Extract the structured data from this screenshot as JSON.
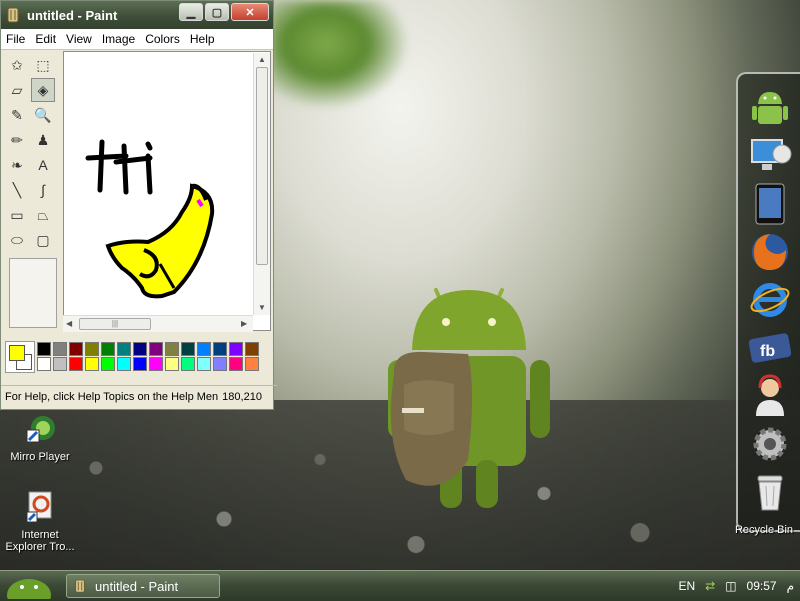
{
  "paint": {
    "window_title": "untitled - Paint",
    "menu": [
      "File",
      "Edit",
      "View",
      "Image",
      "Colors",
      "Help"
    ],
    "status_text": "For Help, click Help Topics on the Help Men",
    "coords": "180,210",
    "tools": [
      {
        "name": "free-form-select-icon",
        "glyph": "✩"
      },
      {
        "name": "select-icon",
        "glyph": "⬚"
      },
      {
        "name": "eraser-icon",
        "glyph": "▱"
      },
      {
        "name": "fill-icon",
        "glyph": "◈"
      },
      {
        "name": "pick-color-icon",
        "glyph": "✎"
      },
      {
        "name": "magnifier-icon",
        "glyph": "🔍"
      },
      {
        "name": "pencil-icon",
        "glyph": "✏"
      },
      {
        "name": "brush-icon",
        "glyph": "♟"
      },
      {
        "name": "airbrush-icon",
        "glyph": "❧"
      },
      {
        "name": "text-icon",
        "glyph": "A"
      },
      {
        "name": "line-icon",
        "glyph": "╲"
      },
      {
        "name": "curve-icon",
        "glyph": "∫"
      },
      {
        "name": "rectangle-icon",
        "glyph": "▭"
      },
      {
        "name": "polygon-icon",
        "glyph": "⏢"
      },
      {
        "name": "ellipse-icon",
        "glyph": "⬭"
      },
      {
        "name": "rounded-rectangle-icon",
        "glyph": "▢"
      }
    ],
    "foreground_color": "#ffff00",
    "background_color": "#ffffff",
    "palette_top": [
      "#000000",
      "#808080",
      "#800000",
      "#808000",
      "#008000",
      "#008080",
      "#000080",
      "#800080",
      "#808040",
      "#004040",
      "#0080ff",
      "#004080",
      "#8000ff",
      "#804000"
    ],
    "palette_bottom": [
      "#ffffff",
      "#c0c0c0",
      "#ff0000",
      "#ffff00",
      "#00ff00",
      "#00ffff",
      "#0000ff",
      "#ff00ff",
      "#ffff80",
      "#00ff80",
      "#80ffff",
      "#8080ff",
      "#ff0080",
      "#ff8040"
    ],
    "canvas_text": "ti"
  },
  "desktop": {
    "icons": [
      {
        "label": "Mirro Player",
        "icon": "mirro-player-icon"
      },
      {
        "label": "Internet Explorer Tro...",
        "icon": "internet-explorer-shortcut-icon"
      }
    ],
    "dock_items": [
      "android-icon",
      "computer-icon",
      "ipad-icon",
      "firefox-icon",
      "internet-explorer-icon",
      "facebook-icon",
      "support-agent-icon",
      "settings-gear-icon",
      "recycle-bin-icon"
    ],
    "recycle_bin_label": "Recycle Bin"
  },
  "taskbar": {
    "task_title": "untitled - Paint",
    "language": "EN",
    "time": "09:57",
    "ampm": "م"
  }
}
